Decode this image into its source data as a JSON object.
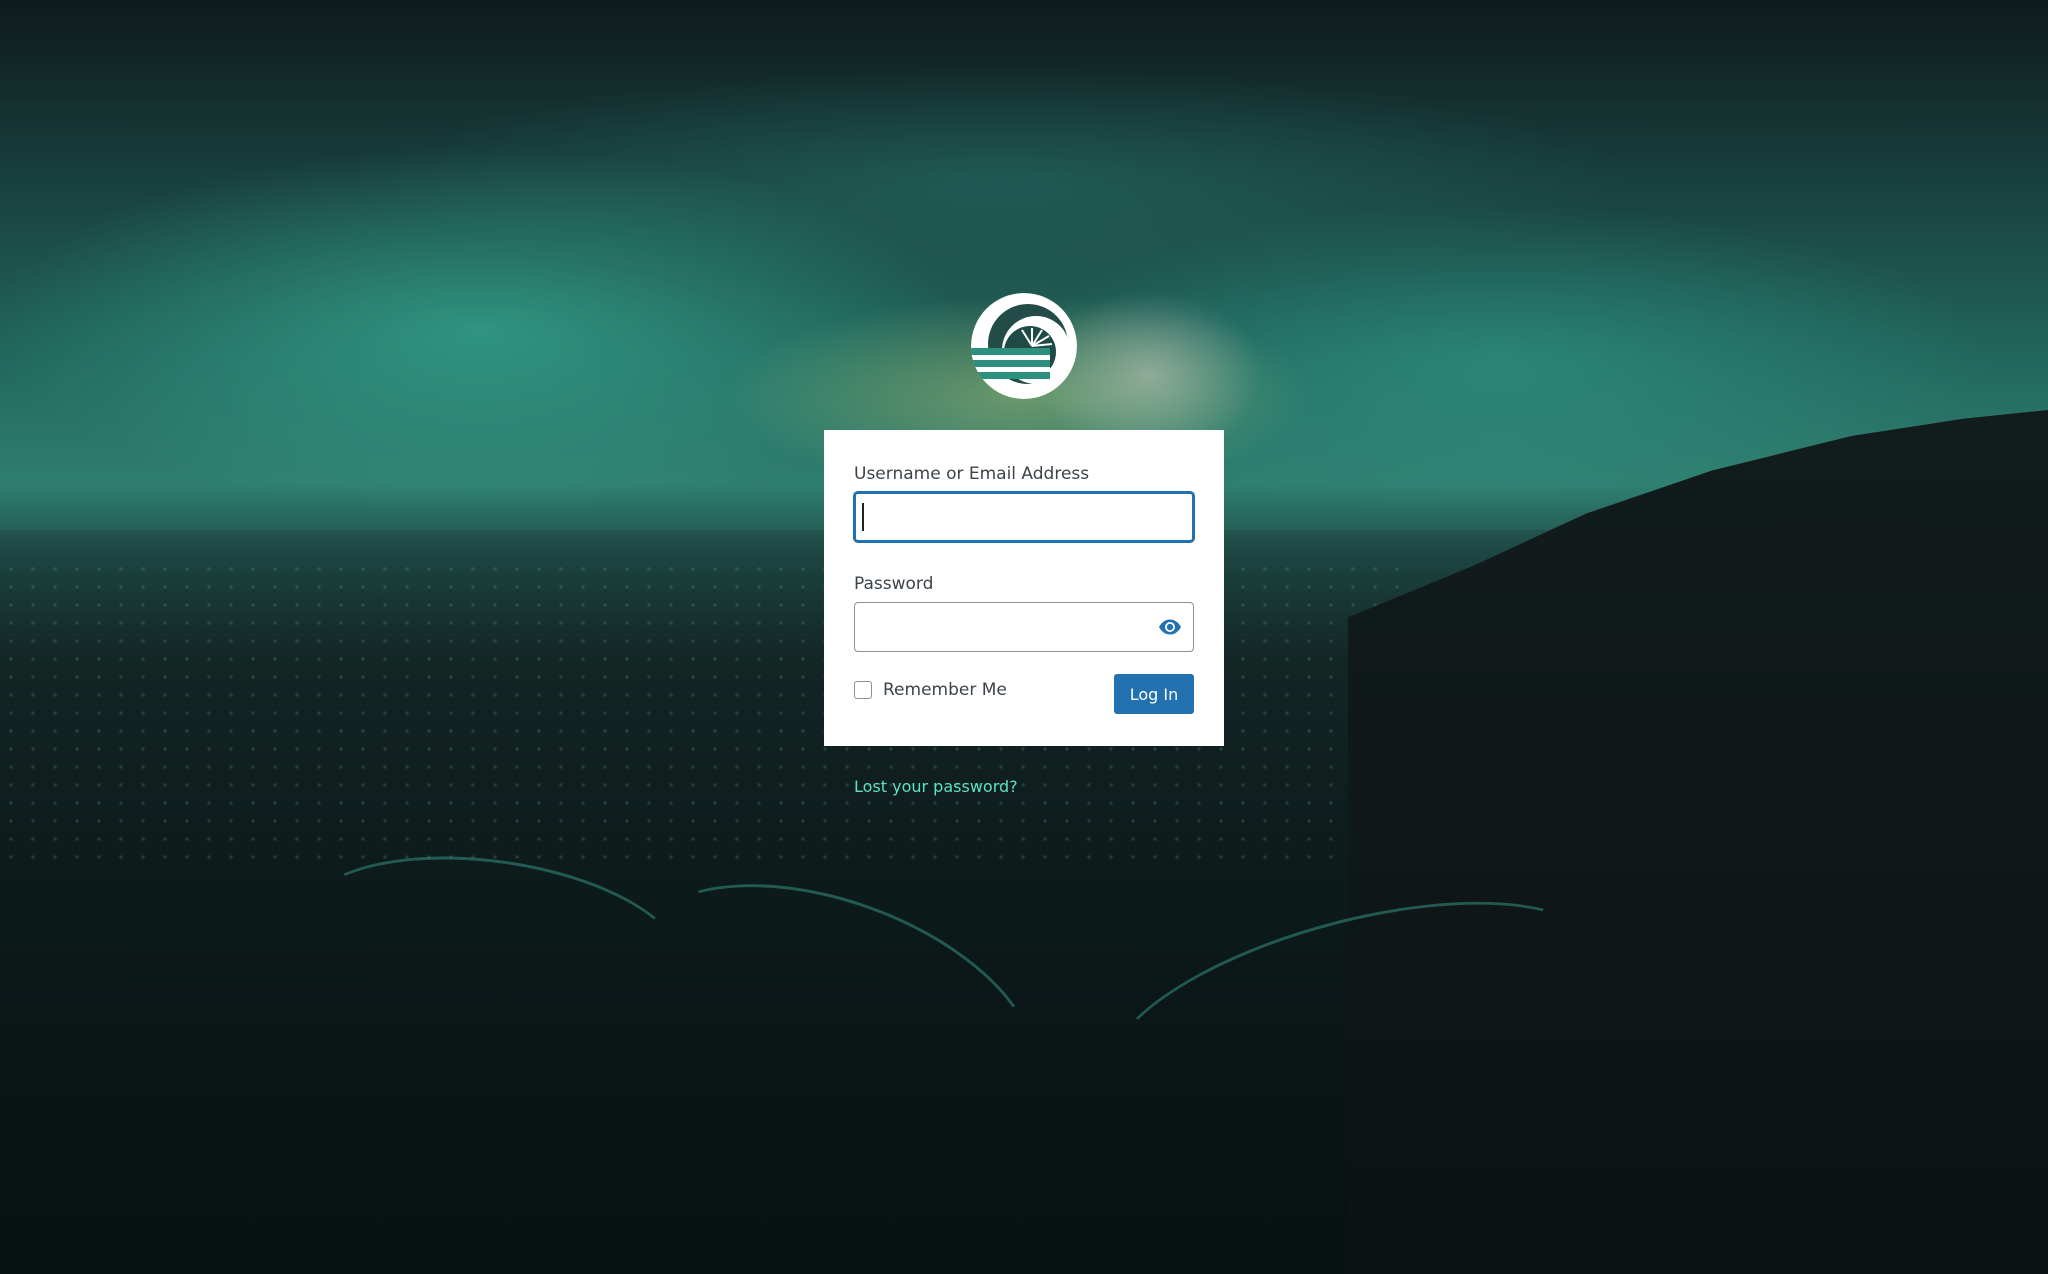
{
  "form": {
    "username_label": "Username or Email Address",
    "username_value": "",
    "password_label": "Password",
    "password_value": "",
    "remember_label": "Remember Me",
    "remember_checked": false,
    "submit_label": "Log In"
  },
  "links": {
    "lost_password": "Lost your password?"
  },
  "icons": {
    "logo": "site-logo",
    "show_password": "eye-icon"
  },
  "colors": {
    "primary_button": "#2271b1",
    "link": "#5fe0c2",
    "panel": "#ffffff"
  }
}
